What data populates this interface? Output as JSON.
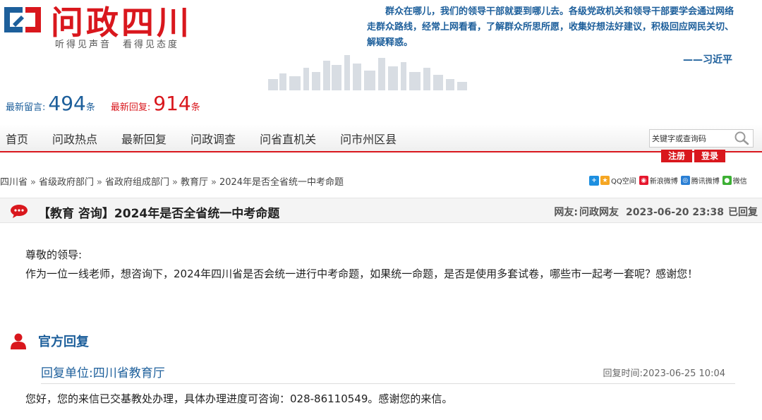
{
  "header": {
    "site_title": "问政四川",
    "slogan": "听得见声音　看得见态度",
    "quote_text": "群众在哪儿，我们的领导干部就要到哪儿去。各级党政机关和领导干部要学会通过网络走群众路线，经常上网看看，了解群众所思所愿，收集好想法好建议，积极回应网民关切、解疑释惑。",
    "quote_author": "——习近平"
  },
  "stats": {
    "latest_messages_label": "最新留言:",
    "latest_messages_count": "494",
    "latest_messages_unit": "条",
    "latest_replies_label": "最新回复:",
    "latest_replies_count": "914",
    "latest_replies_unit": "条"
  },
  "nav": {
    "items": [
      "首页",
      "问政热点",
      "最新回复",
      "问政调查",
      "问省直机关",
      "问市州区县"
    ],
    "search_placeholder": "关键字或查询码",
    "register_label": "注册",
    "login_label": "登录"
  },
  "breadcrumb": {
    "items": [
      "四川省",
      "省级政府部门",
      "省政府组成部门",
      "教育厅",
      "2024年是否全省统一中考命题"
    ],
    "separator": "»"
  },
  "share": {
    "items": [
      {
        "label": "QQ空间",
        "color": "#f5a623"
      },
      {
        "label": "新浪微博",
        "color": "#e6162d"
      },
      {
        "label": "腾讯微博",
        "color": "#2a7fd4"
      },
      {
        "label": "微信",
        "color": "#3cb034"
      }
    ]
  },
  "post": {
    "title": "【教育 咨询】2024年是否全省统一中考命题",
    "user_label": "网友:",
    "user_name": "问政网友",
    "datetime": "2023-06-20 23:38",
    "status": "已回复",
    "greeting": "尊敬的领导:",
    "body": "作为一位一线老师，想咨询下，2024年四川省是否会统一进行中考命题，如果统一命题，是否是使用多套试卷，哪些市一起考一套呢？感谢您！"
  },
  "reply": {
    "section_title": "官方回复",
    "unit_label": "回复单位:",
    "unit_name": "四川省教育厅",
    "time_label": "回复时间:",
    "time_value": "2023-06-25 10:04",
    "content": "您好，您的来信已交基教处办理，具体办理进度可咨询：028-86110549。感谢您的来信。"
  },
  "colors": {
    "brand_red": "#d9171d",
    "brand_blue": "#1d5f9b"
  }
}
